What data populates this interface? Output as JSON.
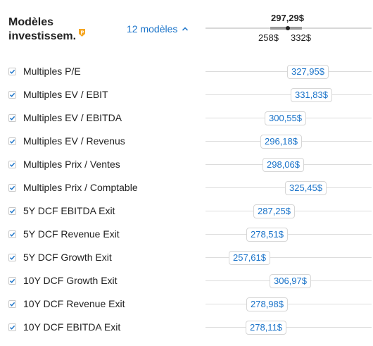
{
  "header": {
    "title_line1": "Modèles",
    "title_line2": "investissem.",
    "models_toggle_label": "12 modèles"
  },
  "range": {
    "fair_value": "297,29$",
    "low": "258$",
    "high": "332$"
  },
  "colors": {
    "accent": "#1a73c9",
    "pro_badge": "#f5a623",
    "checkbox": "#1a73c9"
  },
  "icons": {
    "pro": "pro-badge-icon",
    "toggle": "chevron-up-icon",
    "checkbox": "checkbox-checked-icon"
  },
  "models": [
    {
      "label": "Multiples P/E",
      "value": "327,95$",
      "checked": true
    },
    {
      "label": "Multiples EV / EBIT",
      "value": "331,83$",
      "checked": true
    },
    {
      "label": "Multiples EV / EBITDA",
      "value": "300,55$",
      "checked": true
    },
    {
      "label": "Multiples EV / Revenus",
      "value": "296,18$",
      "checked": true
    },
    {
      "label": "Multiples Prix / Ventes",
      "value": "298,06$",
      "checked": true
    },
    {
      "label": "Multiples Prix / Comptable",
      "value": "325,45$",
      "checked": true
    },
    {
      "label": "5Y DCF EBITDA Exit",
      "value": "287,25$",
      "checked": true
    },
    {
      "label": "5Y DCF Revenue Exit",
      "value": "278,51$",
      "checked": true
    },
    {
      "label": "5Y DCF Growth Exit",
      "value": "257,61$",
      "checked": true
    },
    {
      "label": "10Y DCF Growth Exit",
      "value": "306,97$",
      "checked": true
    },
    {
      "label": "10Y DCF Revenue Exit",
      "value": "278,98$",
      "checked": true
    },
    {
      "label": "10Y DCF EBITDA Exit",
      "value": "278,11$",
      "checked": true
    }
  ]
}
